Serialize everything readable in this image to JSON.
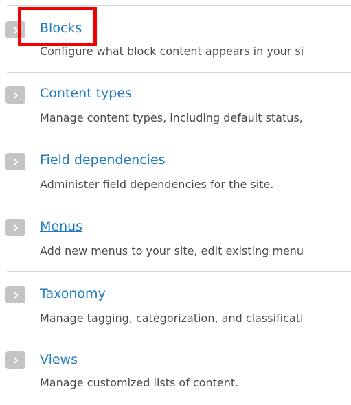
{
  "items": [
    {
      "title": "Blocks",
      "description": "Configure what block content appears in your si"
    },
    {
      "title": "Content types",
      "description": "Manage content types, including default status,"
    },
    {
      "title": "Field dependencies",
      "description": "Administer field dependencies for the site."
    },
    {
      "title": "Menus",
      "description": "Add new menus to your site, edit existing menu"
    },
    {
      "title": "Taxonomy",
      "description": "Manage tagging, categorization, and classificati"
    },
    {
      "title": "Views",
      "description": "Manage customized lists of content."
    }
  ],
  "colors": {
    "link": "#1f7bbf",
    "description_text": "#4a4a4a",
    "chevron_bg": "#c4c4c4",
    "divider": "#d9d9d9",
    "highlight": "#f30000"
  },
  "icons": {
    "item_icon": "chevron-right-icon"
  }
}
